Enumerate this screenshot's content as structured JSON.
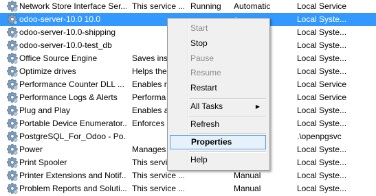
{
  "services": [
    {
      "name": "Network Store Interface Ser...",
      "description": "This service ...",
      "status": "Running",
      "startup": "Automatic",
      "logon": "Local Service",
      "selected": false
    },
    {
      "name": "odoo-server-10.0 10.0",
      "description": "",
      "status": "",
      "startup": "c",
      "logon": "Local Syste...",
      "selected": true
    },
    {
      "name": "odoo-server-10.0-shipping",
      "description": "",
      "status": "",
      "startup": "c",
      "logon": "Local Syste...",
      "selected": false
    },
    {
      "name": "odoo-server-10.0-test_db",
      "description": "",
      "status": "",
      "startup": "c",
      "logon": "Local Syste...",
      "selected": false
    },
    {
      "name": "Office Source Engine",
      "description": "Saves inst",
      "status": "",
      "startup": "",
      "logon": "Local Syste...",
      "selected": false
    },
    {
      "name": "Optimize drives",
      "description": "Helps the",
      "status": "",
      "startup": "",
      "logon": "Local Syste...",
      "selected": false
    },
    {
      "name": "Performance Counter DLL ...",
      "description": "Enables re",
      "status": "",
      "startup": "",
      "logon": "Local Service",
      "selected": false
    },
    {
      "name": "Performance Logs & Alerts",
      "description": "Performa",
      "status": "",
      "startup": "",
      "logon": "Local Service",
      "selected": false
    },
    {
      "name": "Plug and Play",
      "description": "Enables a",
      "status": "",
      "startup": "",
      "logon": "Local Syste...",
      "selected": false
    },
    {
      "name": "Portable Device Enumerator...",
      "description": "Enforces g",
      "status": "",
      "startup": "Trig...",
      "logon": "Local Syste...",
      "selected": false
    },
    {
      "name": "PostgreSQL_For_Odoo - Po...",
      "description": "",
      "status": "",
      "startup": "",
      "logon": ".\\openpgsvc",
      "selected": false
    },
    {
      "name": "Power",
      "description": "Manages",
      "status": "",
      "startup": "",
      "logon": "Local Syste...",
      "selected": false
    },
    {
      "name": "Print Spooler",
      "description": "This servic",
      "status": "",
      "startup": "",
      "logon": "Local Syste...",
      "selected": false
    },
    {
      "name": "Printer Extensions and Notif...",
      "description": "This service ...",
      "status": "",
      "startup": "Manual",
      "logon": "Local Syste...",
      "selected": false
    },
    {
      "name": "Problem Reports and Soluti...",
      "description": "This service ...",
      "status": "",
      "startup": "Manual",
      "logon": "Local Syste...",
      "selected": false
    }
  ],
  "context_menu": {
    "start": "Start",
    "stop": "Stop",
    "pause": "Pause",
    "resume": "Resume",
    "restart": "Restart",
    "all_tasks": "All Tasks",
    "all_tasks_arrow": "▶",
    "refresh": "Refresh",
    "properties": "Properties",
    "help": "Help"
  },
  "colors": {
    "selection": "#3399ff",
    "menu_background": "#f0f0f0",
    "menu_highlight": "#e5f1fb",
    "menu_highlight_border": "#5b9bd5",
    "disabled_text": "#8d8d8d"
  },
  "icons": {
    "service": "gear-icon"
  }
}
